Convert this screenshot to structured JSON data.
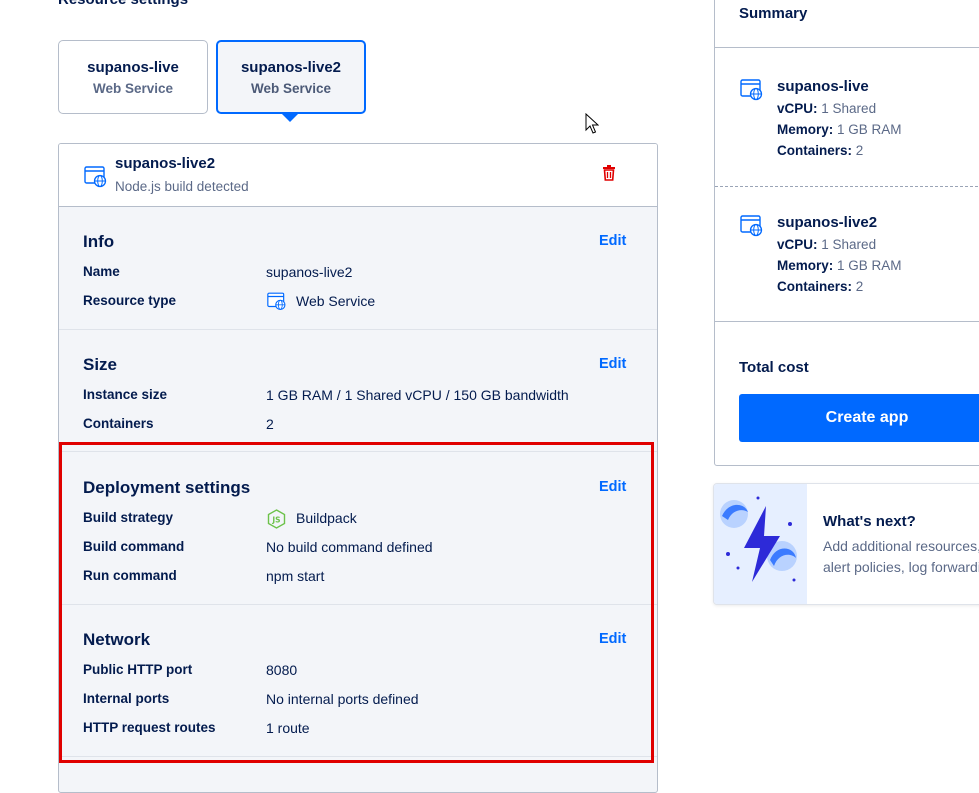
{
  "page": {
    "heading": "Resource settings"
  },
  "resource_tabs": [
    {
      "name": "supanos-live",
      "type": "Web Service"
    },
    {
      "name": "supanos-live2",
      "type": "Web Service"
    }
  ],
  "component": {
    "name": "supanos-live2",
    "detected": "Node.js build detected",
    "info": {
      "title": "Info",
      "edit": "Edit",
      "name_label": "Name",
      "name_value": "supanos-live2",
      "type_label": "Resource type",
      "type_value": "Web Service"
    },
    "size": {
      "title": "Size",
      "edit": "Edit",
      "instance_label": "Instance size",
      "instance_value": "1 GB RAM / 1 Shared vCPU / 150 GB bandwidth",
      "containers_label": "Containers",
      "containers_value": "2"
    },
    "deployment": {
      "title": "Deployment settings",
      "edit": "Edit",
      "strategy_label": "Build strategy",
      "strategy_value": "Buildpack",
      "build_label": "Build command",
      "build_value": "No build command defined",
      "run_label": "Run command",
      "run_value": "npm start"
    },
    "network": {
      "title": "Network",
      "edit": "Edit",
      "port_label": "Public HTTP port",
      "port_value": "8080",
      "internal_label": "Internal ports",
      "internal_value": "No internal ports defined",
      "routes_label": "HTTP request routes",
      "routes_value": "1 route"
    }
  },
  "summary": {
    "title": "Summary",
    "items": [
      {
        "name": "supanos-live",
        "vcpu_label": "vCPU:",
        "vcpu": "1 Shared",
        "memory_label": "Memory:",
        "memory": "1 GB RAM",
        "containers_label": "Containers:",
        "containers": "2"
      },
      {
        "name": "supanos-live2",
        "vcpu_label": "vCPU:",
        "vcpu": "1 Shared",
        "memory_label": "Memory:",
        "memory": "1 GB RAM",
        "containers_label": "Containers:",
        "containers": "2"
      }
    ],
    "total_label": "Total cost",
    "create_button": "Create app"
  },
  "whats_next": {
    "title": "What's next?",
    "line1": "Add additional resources,",
    "line2": "alert policies, log forwardi"
  },
  "colors": {
    "accent": "#0069ff",
    "text": "#031b4e",
    "muted": "#5b6987",
    "danger": "#e00000",
    "node_green": "#6cc24a"
  },
  "icons": {
    "service": "web-service-icon",
    "trash": "trash-icon",
    "node": "nodejs-icon"
  }
}
